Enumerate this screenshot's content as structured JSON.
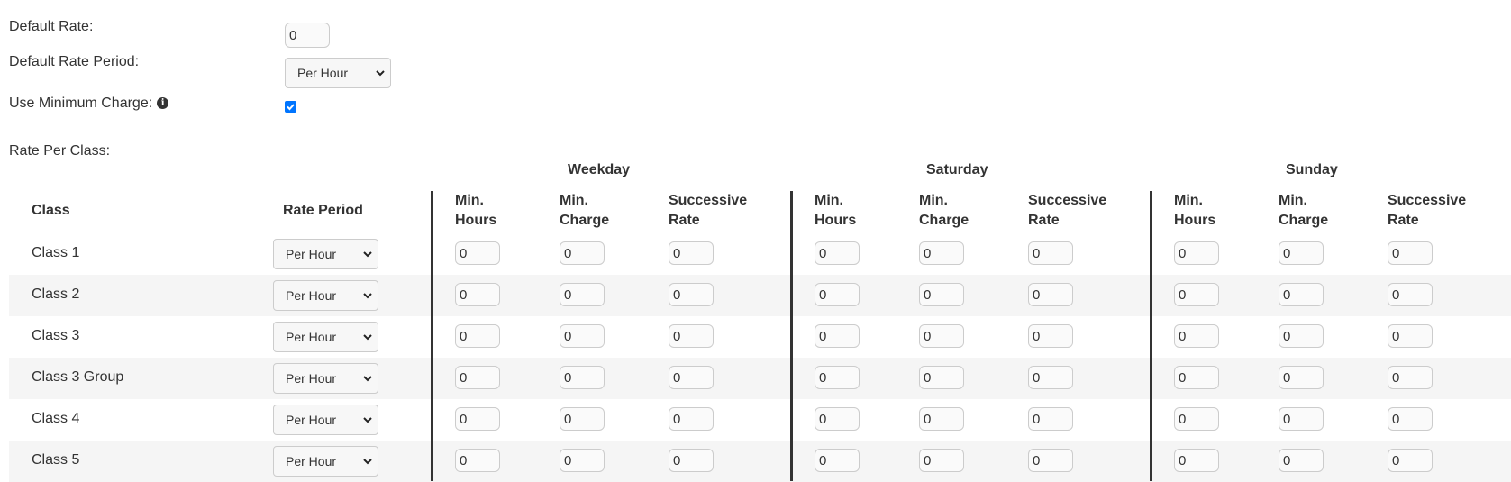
{
  "settings": {
    "default_rate_label": "Default Rate:",
    "default_rate_value": "0",
    "default_rate_period_label": "Default Rate Period:",
    "default_rate_period_value": "Per Hour",
    "use_min_charge_label": "Use Minimum Charge:",
    "use_min_charge_checked": true,
    "rate_per_class_label": "Rate Per Class:"
  },
  "table": {
    "groups": [
      "Weekday",
      "Saturday",
      "Sunday"
    ],
    "class_header": "Class",
    "rate_period_header": "Rate Period",
    "sub_headers": [
      [
        "Min.",
        "Hours"
      ],
      [
        "Min.",
        "Charge"
      ],
      [
        "Successive",
        "Rate"
      ]
    ],
    "rows": [
      {
        "name": "Class 1",
        "period": "Per Hour",
        "values": [
          "0",
          "0",
          "0",
          "0",
          "0",
          "0",
          "0",
          "0",
          "0"
        ]
      },
      {
        "name": "Class 2",
        "period": "Per Hour",
        "values": [
          "0",
          "0",
          "0",
          "0",
          "0",
          "0",
          "0",
          "0",
          "0"
        ]
      },
      {
        "name": "Class 3",
        "period": "Per Hour",
        "values": [
          "0",
          "0",
          "0",
          "0",
          "0",
          "0",
          "0",
          "0",
          "0"
        ]
      },
      {
        "name": "Class 3 Group",
        "period": "Per Hour",
        "values": [
          "0",
          "0",
          "0",
          "0",
          "0",
          "0",
          "0",
          "0",
          "0"
        ]
      },
      {
        "name": "Class 4",
        "period": "Per Hour",
        "values": [
          "0",
          "0",
          "0",
          "0",
          "0",
          "0",
          "0",
          "0",
          "0"
        ]
      },
      {
        "name": "Class 5",
        "period": "Per Hour",
        "values": [
          "0",
          "0",
          "0",
          "0",
          "0",
          "0",
          "0",
          "0",
          "0"
        ]
      }
    ]
  },
  "colors": {
    "checkbox_accent": "#0075ff",
    "alt_row_bg": "#f5f5f5",
    "divider": "#333333"
  },
  "icons": {
    "info": "info-icon",
    "dropdown": "chevron-down-icon",
    "checkmark": "checkmark-icon"
  }
}
